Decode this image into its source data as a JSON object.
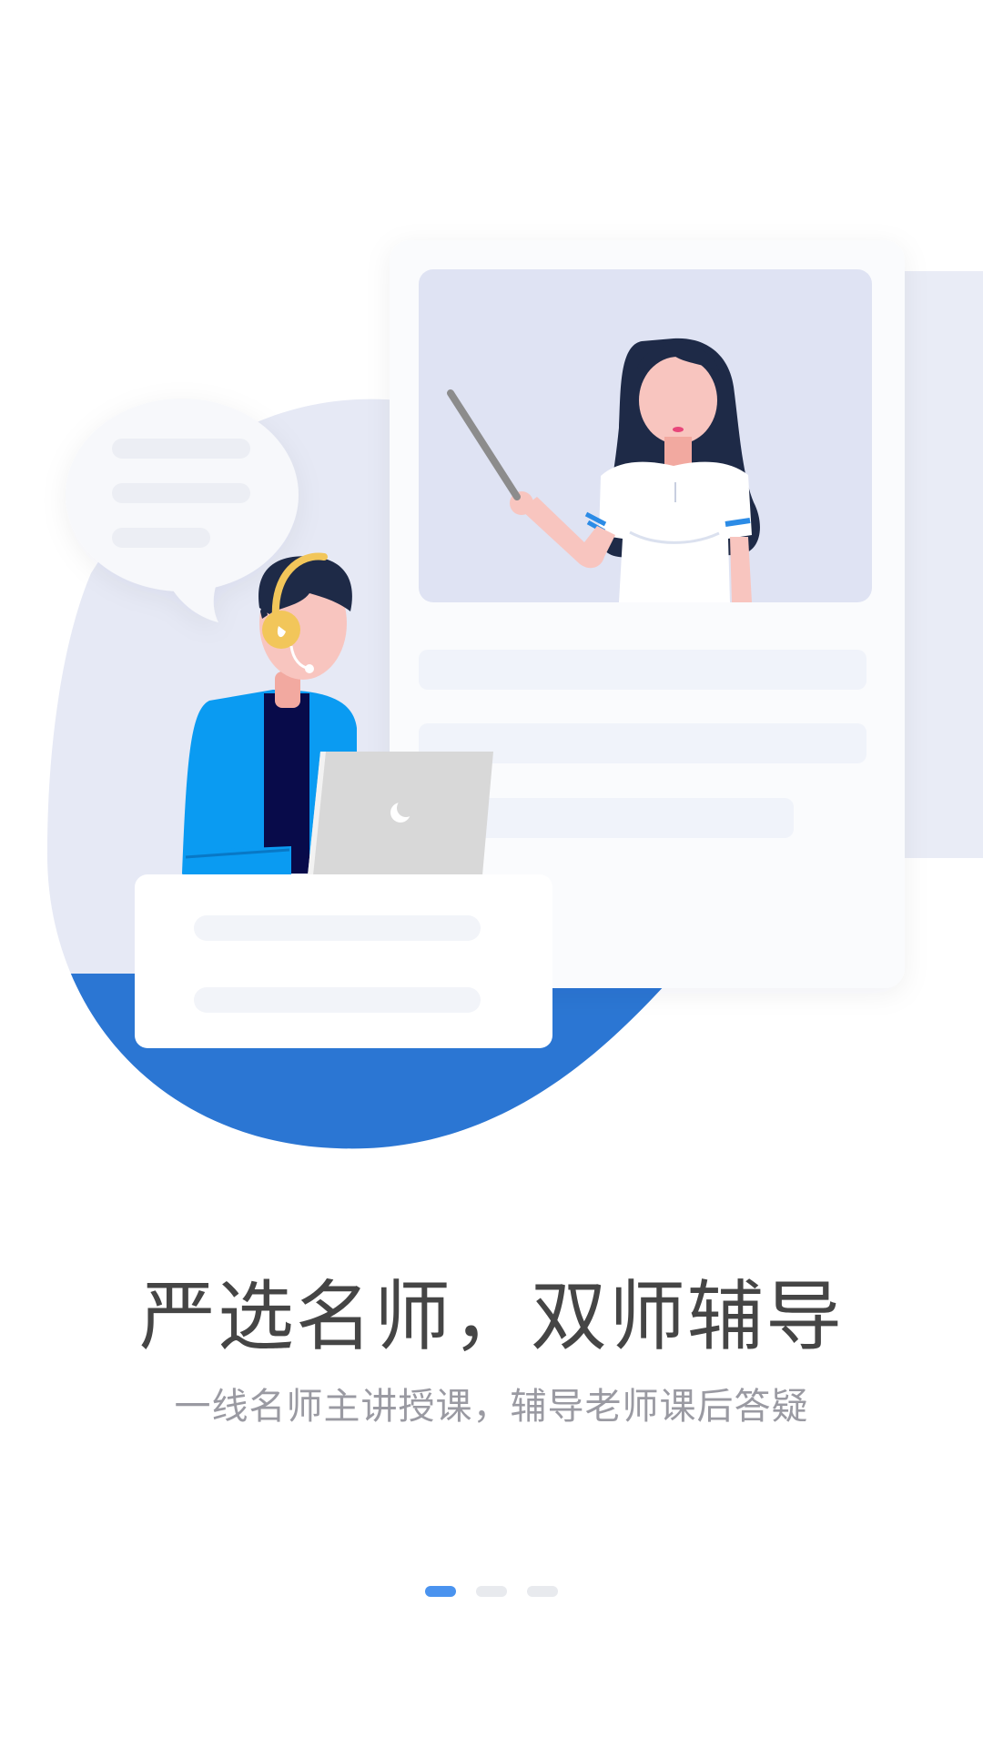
{
  "onboarding": {
    "headline": "严选名师，双师辅导",
    "subline": "一线名师主讲授课，辅导老师课后答疑",
    "pager": {
      "total": 3,
      "current": 1
    }
  },
  "colors": {
    "accent": "#4a93ef",
    "blob_blue": "#2b76d3",
    "blob_light": "#e6e9f5",
    "video_bg": "#dfe3f3",
    "text_dark": "#454545",
    "text_gray": "#9a9aa2"
  },
  "icons": [
    "speech-bubble-icon",
    "headset-icon",
    "laptop-icon",
    "moon-logo-icon",
    "pointer-stick-icon"
  ]
}
